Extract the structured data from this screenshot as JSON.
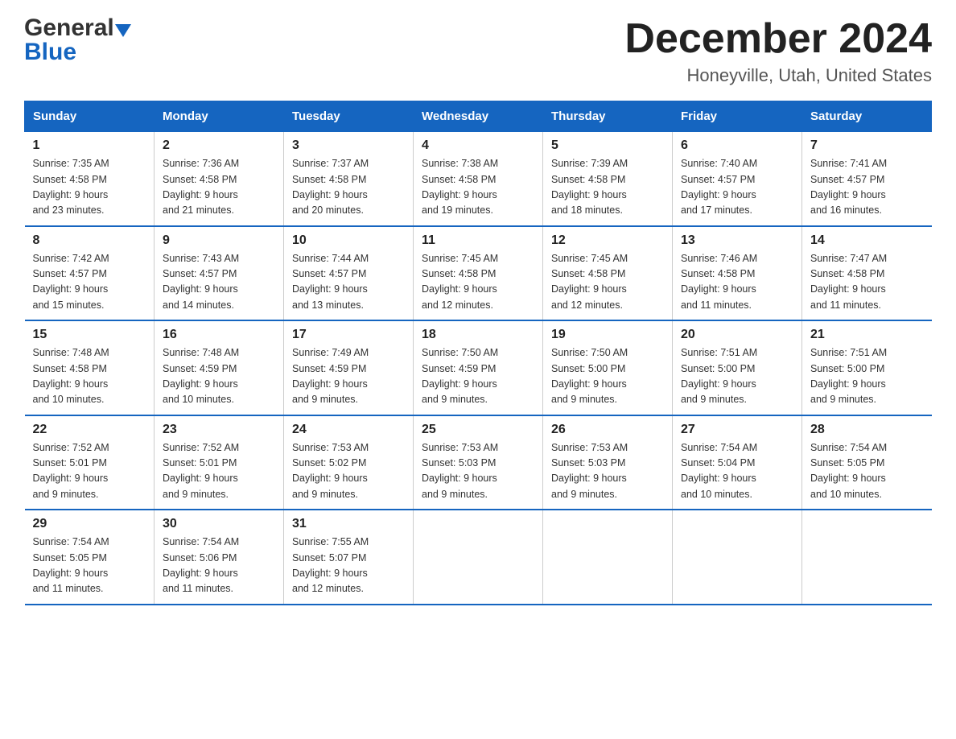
{
  "header": {
    "title": "December 2024",
    "subtitle": "Honeyville, Utah, United States",
    "logo_general": "General",
    "logo_blue": "Blue"
  },
  "days_of_week": [
    "Sunday",
    "Monday",
    "Tuesday",
    "Wednesday",
    "Thursday",
    "Friday",
    "Saturday"
  ],
  "weeks": [
    [
      {
        "day": "1",
        "sunrise": "7:35 AM",
        "sunset": "4:58 PM",
        "daylight": "9 hours and 23 minutes."
      },
      {
        "day": "2",
        "sunrise": "7:36 AM",
        "sunset": "4:58 PM",
        "daylight": "9 hours and 21 minutes."
      },
      {
        "day": "3",
        "sunrise": "7:37 AM",
        "sunset": "4:58 PM",
        "daylight": "9 hours and 20 minutes."
      },
      {
        "day": "4",
        "sunrise": "7:38 AM",
        "sunset": "4:58 PM",
        "daylight": "9 hours and 19 minutes."
      },
      {
        "day": "5",
        "sunrise": "7:39 AM",
        "sunset": "4:58 PM",
        "daylight": "9 hours and 18 minutes."
      },
      {
        "day": "6",
        "sunrise": "7:40 AM",
        "sunset": "4:57 PM",
        "daylight": "9 hours and 17 minutes."
      },
      {
        "day": "7",
        "sunrise": "7:41 AM",
        "sunset": "4:57 PM",
        "daylight": "9 hours and 16 minutes."
      }
    ],
    [
      {
        "day": "8",
        "sunrise": "7:42 AM",
        "sunset": "4:57 PM",
        "daylight": "9 hours and 15 minutes."
      },
      {
        "day": "9",
        "sunrise": "7:43 AM",
        "sunset": "4:57 PM",
        "daylight": "9 hours and 14 minutes."
      },
      {
        "day": "10",
        "sunrise": "7:44 AM",
        "sunset": "4:57 PM",
        "daylight": "9 hours and 13 minutes."
      },
      {
        "day": "11",
        "sunrise": "7:45 AM",
        "sunset": "4:58 PM",
        "daylight": "9 hours and 12 minutes."
      },
      {
        "day": "12",
        "sunrise": "7:45 AM",
        "sunset": "4:58 PM",
        "daylight": "9 hours and 12 minutes."
      },
      {
        "day": "13",
        "sunrise": "7:46 AM",
        "sunset": "4:58 PM",
        "daylight": "9 hours and 11 minutes."
      },
      {
        "day": "14",
        "sunrise": "7:47 AM",
        "sunset": "4:58 PM",
        "daylight": "9 hours and 11 minutes."
      }
    ],
    [
      {
        "day": "15",
        "sunrise": "7:48 AM",
        "sunset": "4:58 PM",
        "daylight": "9 hours and 10 minutes."
      },
      {
        "day": "16",
        "sunrise": "7:48 AM",
        "sunset": "4:59 PM",
        "daylight": "9 hours and 10 minutes."
      },
      {
        "day": "17",
        "sunrise": "7:49 AM",
        "sunset": "4:59 PM",
        "daylight": "9 hours and 9 minutes."
      },
      {
        "day": "18",
        "sunrise": "7:50 AM",
        "sunset": "4:59 PM",
        "daylight": "9 hours and 9 minutes."
      },
      {
        "day": "19",
        "sunrise": "7:50 AM",
        "sunset": "5:00 PM",
        "daylight": "9 hours and 9 minutes."
      },
      {
        "day": "20",
        "sunrise": "7:51 AM",
        "sunset": "5:00 PM",
        "daylight": "9 hours and 9 minutes."
      },
      {
        "day": "21",
        "sunrise": "7:51 AM",
        "sunset": "5:00 PM",
        "daylight": "9 hours and 9 minutes."
      }
    ],
    [
      {
        "day": "22",
        "sunrise": "7:52 AM",
        "sunset": "5:01 PM",
        "daylight": "9 hours and 9 minutes."
      },
      {
        "day": "23",
        "sunrise": "7:52 AM",
        "sunset": "5:01 PM",
        "daylight": "9 hours and 9 minutes."
      },
      {
        "day": "24",
        "sunrise": "7:53 AM",
        "sunset": "5:02 PM",
        "daylight": "9 hours and 9 minutes."
      },
      {
        "day": "25",
        "sunrise": "7:53 AM",
        "sunset": "5:03 PM",
        "daylight": "9 hours and 9 minutes."
      },
      {
        "day": "26",
        "sunrise": "7:53 AM",
        "sunset": "5:03 PM",
        "daylight": "9 hours and 9 minutes."
      },
      {
        "day": "27",
        "sunrise": "7:54 AM",
        "sunset": "5:04 PM",
        "daylight": "9 hours and 10 minutes."
      },
      {
        "day": "28",
        "sunrise": "7:54 AM",
        "sunset": "5:05 PM",
        "daylight": "9 hours and 10 minutes."
      }
    ],
    [
      {
        "day": "29",
        "sunrise": "7:54 AM",
        "sunset": "5:05 PM",
        "daylight": "9 hours and 11 minutes."
      },
      {
        "day": "30",
        "sunrise": "7:54 AM",
        "sunset": "5:06 PM",
        "daylight": "9 hours and 11 minutes."
      },
      {
        "day": "31",
        "sunrise": "7:55 AM",
        "sunset": "5:07 PM",
        "daylight": "9 hours and 12 minutes."
      },
      null,
      null,
      null,
      null
    ]
  ],
  "labels": {
    "sunrise": "Sunrise:",
    "sunset": "Sunset:",
    "daylight": "Daylight:"
  }
}
